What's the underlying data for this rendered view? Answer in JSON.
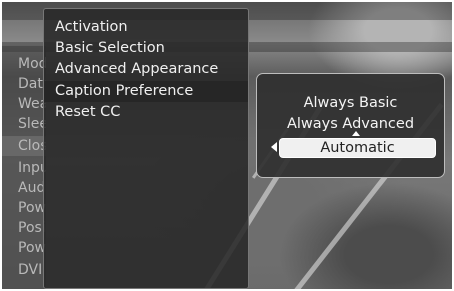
{
  "background_menu": {
    "items": [
      {
        "label": "Mode",
        "highlight": false
      },
      {
        "label": "Date",
        "highlight": false
      },
      {
        "label": "Weather",
        "highlight": false
      },
      {
        "label": "Sleep",
        "highlight": false
      },
      {
        "label": "Closed Caption",
        "highlight": true
      },
      {
        "label": "Input",
        "highlight": false
      },
      {
        "label": "Audio",
        "highlight": false
      },
      {
        "label": "Power",
        "highlight": false
      },
      {
        "label": "Position",
        "highlight": false
      },
      {
        "label": "Power",
        "highlight": false
      },
      {
        "label": "DVI",
        "highlight": false
      }
    ]
  },
  "cc_menu": {
    "items": [
      {
        "label": "Activation"
      },
      {
        "label": "Basic Selection"
      },
      {
        "label": "Advanced Appearance"
      },
      {
        "label": "Caption Preference"
      },
      {
        "label": "Reset CC"
      }
    ],
    "selected_index": 3
  },
  "popup": {
    "options": [
      "Always Basic",
      "Always Advanced",
      "Automatic"
    ],
    "selected": "Automatic"
  }
}
